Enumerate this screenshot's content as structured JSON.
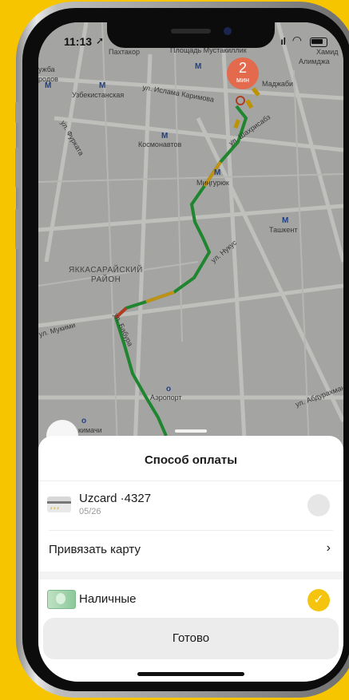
{
  "status_bar": {
    "time": "11:13",
    "signal": "ıl"
  },
  "map": {
    "labels": [
      "Пахтакор",
      "Площадь Мустакиллик",
      "ужба",
      "родов",
      "Узбекистанская",
      "ул. Ислама Каримова",
      "Космонавтов",
      "ул. Фурката",
      "Миңгурюк",
      "ул. Шахрисабз",
      "Ташкент",
      "ул. Нукус",
      "ЯККАСАРАЙСКИЙ",
      "РАЙОН",
      "ул. Мукими",
      "ул. Бабура",
      "Аэропорт",
      "ул. Абдурахмана",
      "кимачи",
      "Хамид",
      "Алимджа",
      "Маджаби"
    ],
    "eta": {
      "value": "2",
      "unit": "мин"
    }
  },
  "sheet": {
    "title": "Способ оплаты",
    "card": {
      "name": "Uzcard ·4327",
      "expiry": "05/26"
    },
    "link_card": "Привязать карту",
    "cash": "Наличные",
    "done": "Готово"
  }
}
